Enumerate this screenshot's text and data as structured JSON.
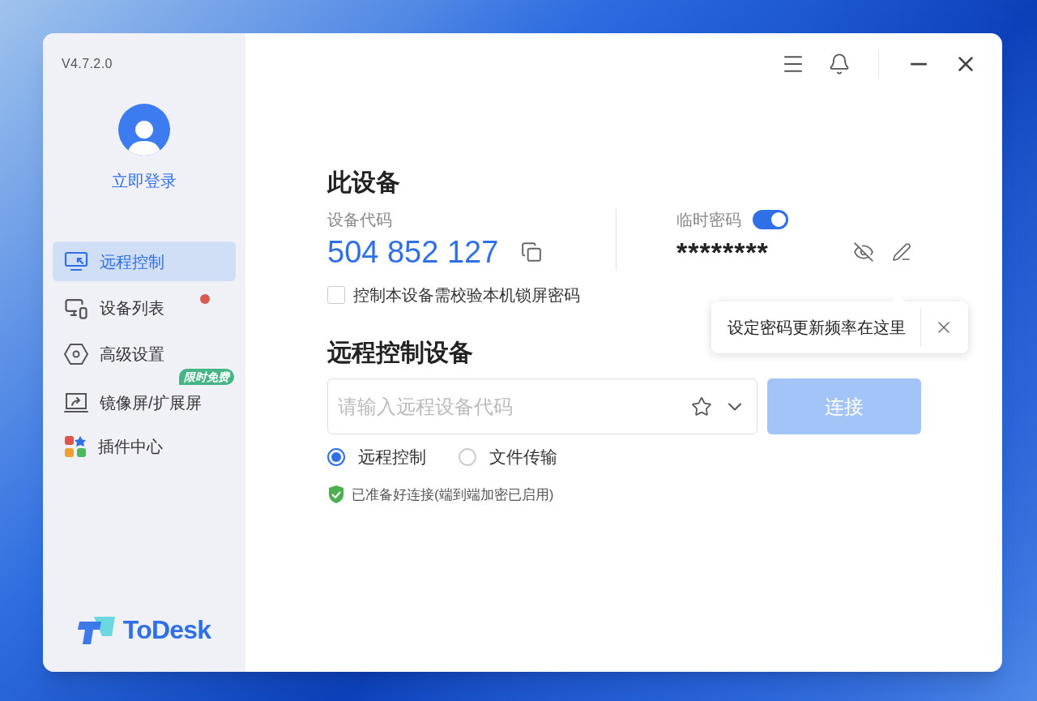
{
  "version": "V4.7.2.0",
  "account": {
    "label": "立即登录"
  },
  "nav": [
    {
      "kind": "remote",
      "label": "远程控制",
      "selected": true,
      "unread": false
    },
    {
      "kind": "devices",
      "label": "设备列表",
      "selected": false,
      "unread": true
    },
    {
      "kind": "settings",
      "label": "高级设置",
      "selected": false,
      "unread": false
    },
    {
      "kind": "mirror",
      "label": "镜像屏/扩展屏",
      "selected": false,
      "unread": false,
      "badge": "限时免费"
    },
    {
      "kind": "plugins",
      "label": "插件中心",
      "selected": false,
      "unread": false
    }
  ],
  "brand": "ToDesk",
  "this_device": {
    "title": "此设备",
    "code_label": "设备代码",
    "code": "504 852 127",
    "password_label": "临时密码",
    "password_on": true,
    "password": "********",
    "lock_option": {
      "label": "控制本设备需校验本机锁屏密码",
      "checked": false
    }
  },
  "tooltip": {
    "text": "设定密码更新频率在这里"
  },
  "remote": {
    "title": "远程控制设备",
    "placeholder": "请输入远程设备代码",
    "connect": "连接",
    "connect_disabled": true,
    "modes": [
      {
        "label": "远程控制",
        "selected": true
      },
      {
        "label": "文件传输",
        "selected": false
      }
    ],
    "status": "已准备好连接(端到端加密已启用)"
  }
}
